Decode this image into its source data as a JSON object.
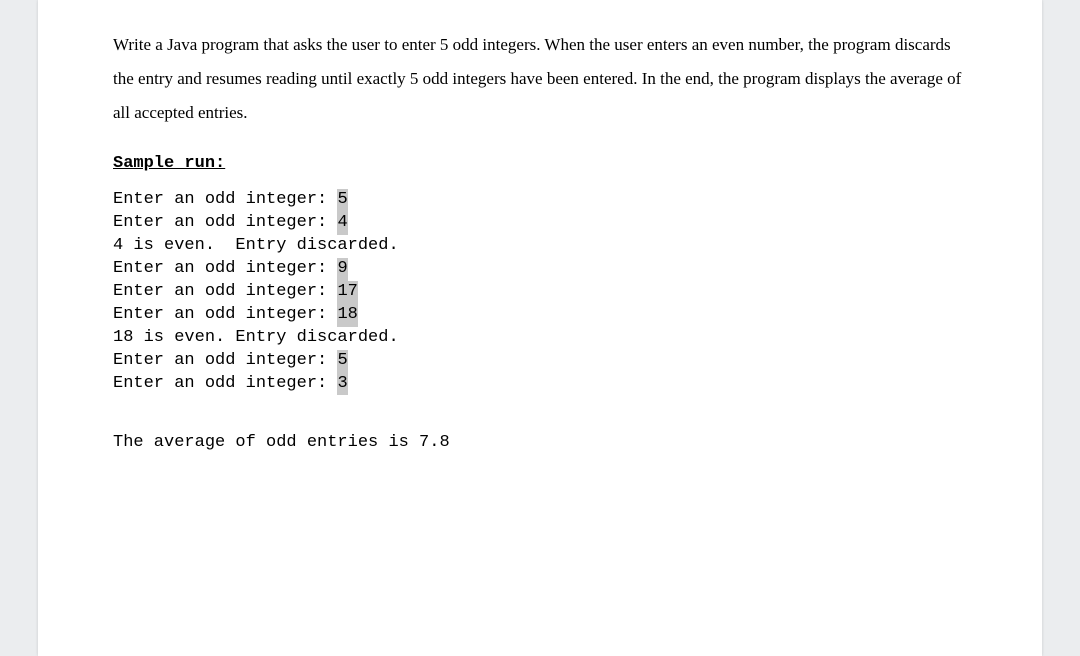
{
  "problem": {
    "text": "Write a Java program that asks the user to enter 5 odd integers. When the user enters an even number, the program discards the entry and resumes reading until exactly 5 odd integers have been entered. In the end, the program displays the average of all accepted entries."
  },
  "sample_run_label": "Sample run:",
  "console": {
    "prompt_text": "Enter an odd integer: ",
    "lines": [
      {
        "type": "prompt",
        "input": "5"
      },
      {
        "type": "prompt",
        "input": "4"
      },
      {
        "type": "message",
        "text": "4 is even.  Entry discarded."
      },
      {
        "type": "prompt",
        "input": "9"
      },
      {
        "type": "prompt",
        "input": "17"
      },
      {
        "type": "prompt",
        "input": "18"
      },
      {
        "type": "message",
        "text": "18 is even. Entry discarded."
      },
      {
        "type": "prompt",
        "input": "5"
      },
      {
        "type": "prompt",
        "input": "3"
      }
    ]
  },
  "result": "The average of odd entries is 7.8"
}
